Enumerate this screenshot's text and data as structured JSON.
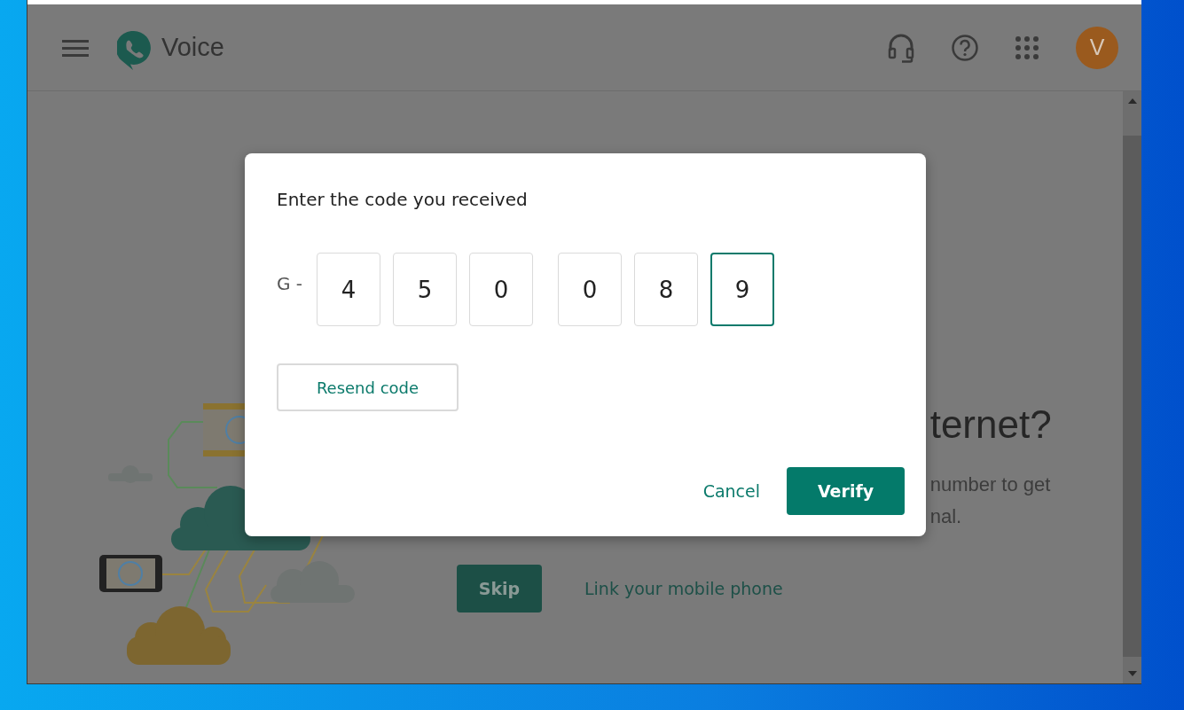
{
  "app_bar": {
    "title": "Voice",
    "avatar_initial": "V"
  },
  "page": {
    "heading_fragment": "ternet?",
    "text_fragments": [
      "number to get",
      "nal."
    ],
    "buttons": [
      {
        "label": "Skip",
        "kind": "primary"
      },
      {
        "label": "Link your mobile phone",
        "kind": "link"
      }
    ]
  },
  "dialog": {
    "title": "Enter the code you received",
    "prefix": "G -",
    "digits": [
      {
        "value": "4",
        "selected": false
      },
      {
        "value": "5",
        "selected": false
      },
      {
        "value": "0",
        "selected": false
      },
      {
        "value": "0",
        "selected": false
      },
      {
        "value": "8",
        "selected": false
      },
      {
        "value": "9",
        "selected": true
      }
    ],
    "resend_button": "Resend code",
    "buttons": [
      {
        "label": "Cancel",
        "kind": "text"
      },
      {
        "label": "Verify",
        "kind": "primary"
      }
    ]
  }
}
